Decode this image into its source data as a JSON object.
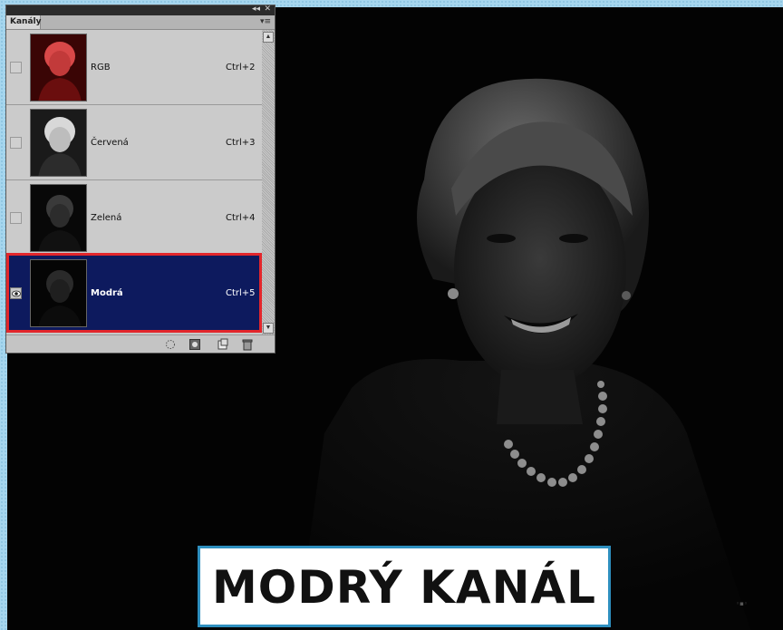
{
  "panel": {
    "tab_label": "Kanály",
    "channels": [
      {
        "name": "RGB",
        "shortcut": "Ctrl+2",
        "visible": false,
        "selected": false
      },
      {
        "name": "Červená",
        "shortcut": "Ctrl+3",
        "visible": false,
        "selected": false
      },
      {
        "name": "Zelená",
        "shortcut": "Ctrl+4",
        "visible": false,
        "selected": false
      },
      {
        "name": "Modrá",
        "shortcut": "Ctrl+5",
        "visible": true,
        "selected": true
      }
    ],
    "footer_icons": [
      "load-selection-icon",
      "save-selection-icon",
      "new-channel-icon",
      "trash-icon"
    ]
  },
  "caption": {
    "text": "MODRÝ KANÁL"
  },
  "colors": {
    "frame": "#a6d6ee",
    "selected_row": "#0d1a5e",
    "highlight": "#e3262b",
    "caption_border": "#2e8fbf"
  }
}
